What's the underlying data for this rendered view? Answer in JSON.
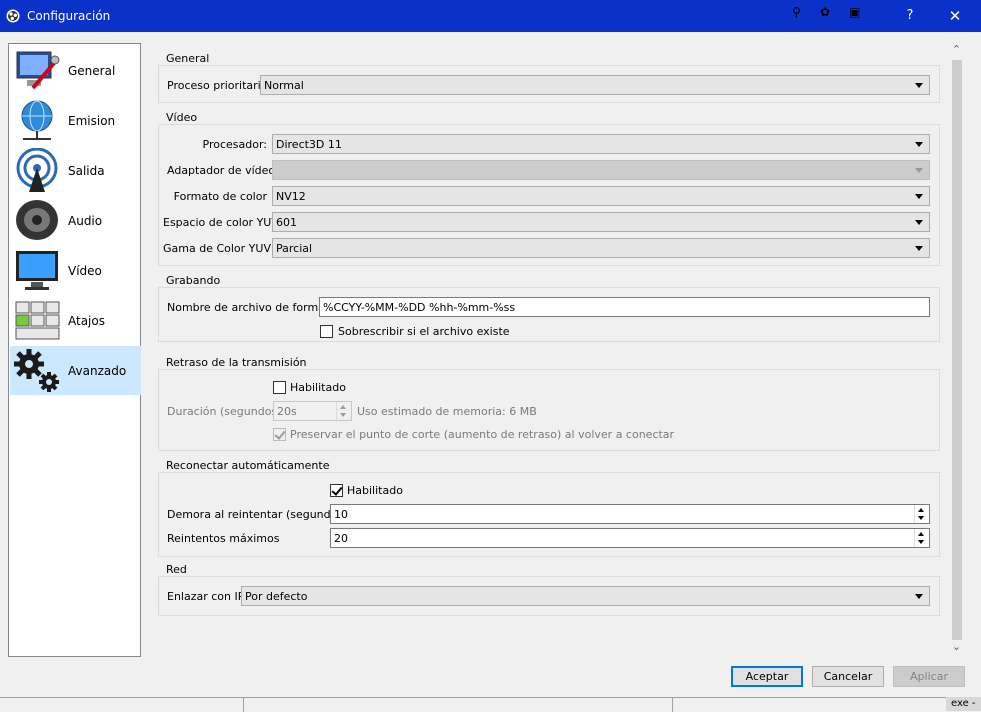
{
  "window": {
    "title": "Configuración",
    "help_label": "?",
    "close_label": "✕"
  },
  "sidebar": {
    "items": [
      {
        "label": "General",
        "icon": "monitor-wrench-icon"
      },
      {
        "label": "Emision",
        "icon": "globe-network-icon"
      },
      {
        "label": "Salida",
        "icon": "broadcast-tower-icon"
      },
      {
        "label": "Audio",
        "icon": "speaker-icon"
      },
      {
        "label": "Vídeo",
        "icon": "monitor-icon"
      },
      {
        "label": "Atajos",
        "icon": "keyboard-keys-icon"
      },
      {
        "label": "Avanzado",
        "icon": "gears-icon"
      }
    ],
    "selected": "Avanzado"
  },
  "general": {
    "title": "General",
    "priority_label": "Proceso prioritario",
    "priority_value": "Normal"
  },
  "video": {
    "title": "Vídeo",
    "renderer_label": "Procesador:",
    "renderer_value": "Direct3D 11",
    "adapter_label": "Adaptador de vídeo:",
    "adapter_value": "",
    "color_format_label": "Formato de color",
    "color_format_value": "NV12",
    "yuv_space_label": "Espacio de color YUV",
    "yuv_space_value": "601",
    "yuv_range_label": "Gama de Color YUV",
    "yuv_range_value": "Parcial"
  },
  "recording": {
    "title": "Grabando",
    "filename_label": "Nombre de archivo de formato",
    "filename_value": "%CCYY-%MM-%DD %hh-%mm-%ss",
    "overwrite_label": "Sobrescribir si el archivo existe",
    "overwrite_checked": false
  },
  "stream_delay": {
    "title": "Retraso de la transmisión",
    "enabled_label": "Habilitado",
    "enabled_checked": false,
    "duration_label": "Duración (segundos)",
    "duration_value": "20s",
    "memory_text": "Uso estimado de memoria: 6 MB",
    "preserve_label": "Preservar el punto de corte (aumento de retraso) al volver a conectar",
    "preserve_checked": true
  },
  "reconnect": {
    "title": "Reconectar automáticamente",
    "enabled_label": "Habilitado",
    "enabled_checked": true,
    "retry_delay_label": "Demora al reintentar (segundos)",
    "retry_delay_value": "10",
    "max_retries_label": "Reintentos máximos",
    "max_retries_value": "20"
  },
  "network": {
    "title": "Red",
    "bind_ip_label": "Enlazar con IP",
    "bind_ip_value": "Por defecto"
  },
  "buttons": {
    "accept": "Aceptar",
    "cancel": "Cancelar",
    "apply": "Aplicar"
  },
  "taskbar_fragment": "exe -",
  "colors": {
    "titlebar": "#0a32c8",
    "selection": "#cce8ff",
    "default_button_border": "#0078d7"
  }
}
